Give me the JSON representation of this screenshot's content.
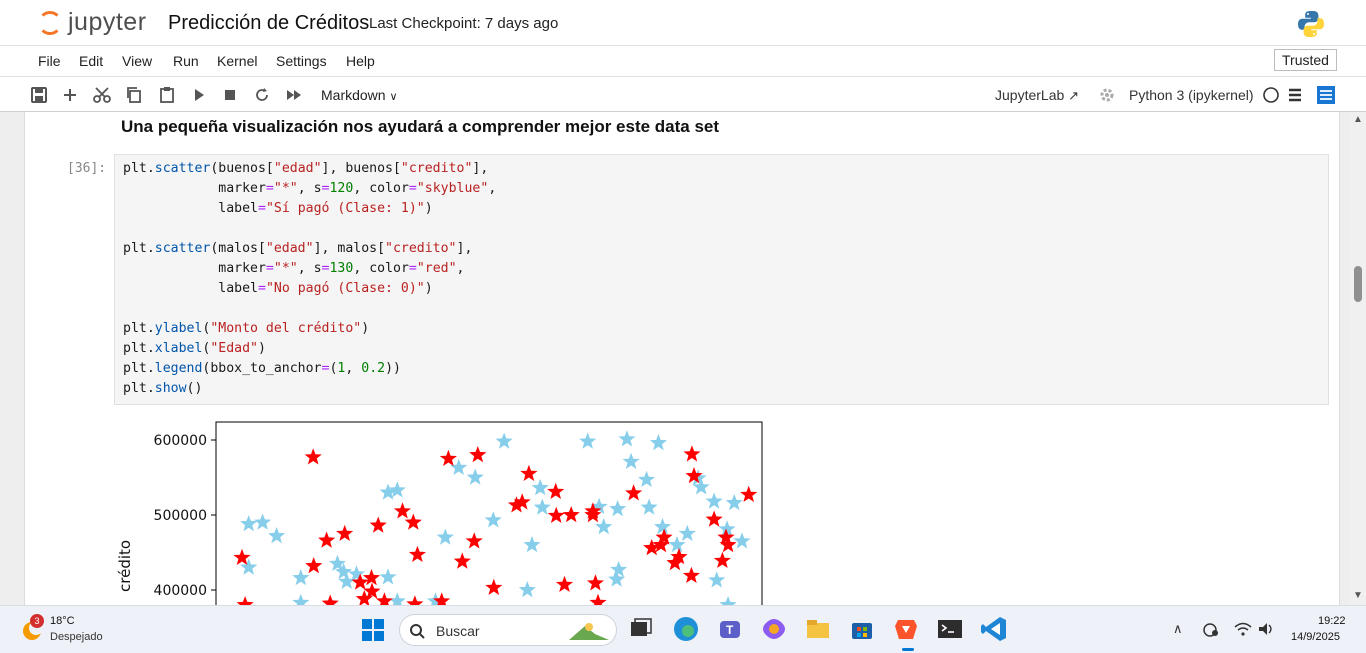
{
  "header": {
    "logo_text": "jupyter",
    "notebook_title": "Predicción de Créditos",
    "checkpoint": "Last Checkpoint: 7 days ago"
  },
  "menu": {
    "items": [
      "File",
      "Edit",
      "View",
      "Run",
      "Kernel",
      "Settings",
      "Help"
    ],
    "trusted": "Trusted"
  },
  "toolbar": {
    "cell_type": "Markdown",
    "jupyterlab": "JupyterLab",
    "kernel": "Python 3 (ipykernel)"
  },
  "notebook": {
    "markdown_heading": "Una pequeña visualización nos ayudará a comprender mejor este data set",
    "code_prompt": "[36]:"
  },
  "chart_data": {
    "type": "scatter",
    "ylabel": "crédito",
    "yticks": [
      "600000",
      "500000",
      "400000"
    ],
    "y_tick_values": [
      600000,
      500000,
      400000
    ],
    "ylim": [
      370000,
      625000
    ],
    "xlim": [
      0,
      100
    ],
    "series": [
      {
        "name": "",
        "color": "#87ceeb",
        "marker": "star",
        "x": [
          4.4,
          7.1,
          9.8,
          4.4,
          14.5,
          21.6,
          25.3,
          23.4,
          31.4,
          33.2,
          42.5,
          48.3,
          45.1,
          51.8,
          53.9,
          59.3,
          60.9,
          70.1,
          72.3,
          75.9,
          77.7,
          78.5,
          81.5,
          83.8,
          87.4,
          91.5,
          92.1,
          98.5,
          97.1,
          82.0,
          14.5,
          33.2,
          31.4,
          22.8,
          40.6,
          58.4,
          73.2,
          84.6,
          89.4,
          76.1,
          75.7,
          95.1,
          97.3,
          100.0,
          61.3,
          94.6
        ],
        "y": [
          488000,
          490000,
          472000,
          430000,
          416000,
          435000,
          421000,
          411000,
          530000,
          533000,
          470000,
          550000,
          563000,
          493000,
          598000,
          460000,
          536000,
          598000,
          511000,
          508000,
          601000,
          571000,
          547000,
          596000,
          460000,
          549000,
          537000,
          516000,
          481000,
          510000,
          383000,
          385000,
          417000,
          424000,
          385000,
          400000,
          484000,
          484000,
          475000,
          427000,
          414000,
          413000,
          380000,
          465000,
          510000,
          518000
        ]
      },
      {
        "name": "",
        "color": "#ff0000",
        "marker": "star",
        "x": [
          3.1,
          16.9,
          17.0,
          19.5,
          23.0,
          26.8,
          28.2,
          30.7,
          29.5,
          34.2,
          36.3,
          37.1,
          43.1,
          45.8,
          48.1,
          48.8,
          51.9,
          56.3,
          57.4,
          58.7,
          63.9,
          64.0,
          65.6,
          66.9,
          71.1,
          72.1,
          71.6,
          71.1,
          79.0,
          82.5,
          84.3,
          84.9,
          87.8,
          87.0,
          90.2,
          90.3,
          90.7,
          94.6,
          96.2,
          96.9,
          97.3,
          101.3,
          3.7,
          28.3,
          26.0,
          20.2,
          36.6,
          41.8
        ],
        "y": [
          443000,
          577000,
          432000,
          466000,
          475000,
          388000,
          416000,
          385000,
          486000,
          505000,
          490000,
          447000,
          575000,
          438000,
          465000,
          580000,
          403000,
          513000,
          517000,
          555000,
          531000,
          499000,
          407000,
          500000,
          505000,
          383000,
          409000,
          500000,
          529000,
          456000,
          460000,
          470000,
          444000,
          436000,
          419000,
          581000,
          552000,
          494000,
          439000,
          470000,
          460000,
          527000,
          380000,
          398000,
          410000,
          382000,
          381000,
          385000
        ]
      }
    ]
  },
  "taskbar": {
    "weather_badge": "3",
    "weather_temp": "18°C",
    "weather_desc": "Despejado",
    "search_placeholder": "Buscar",
    "time": "19:22",
    "date": "14/9/2025"
  }
}
